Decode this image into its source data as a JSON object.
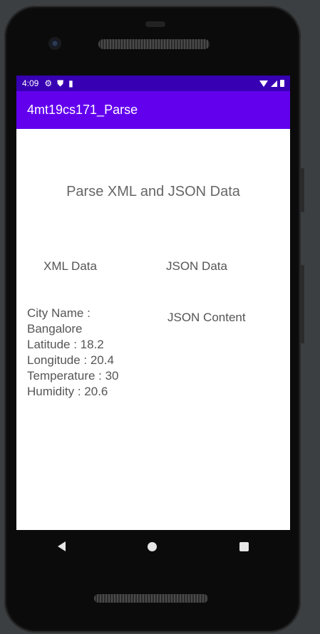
{
  "status_bar": {
    "time": "4:09",
    "icons_left": [
      "settings-icon",
      "shield-icon",
      "sd-card-icon"
    ],
    "icons_right": [
      "wifi-icon",
      "signal-icon",
      "battery-icon"
    ]
  },
  "app_bar": {
    "title": "4mt19cs171_Parse",
    "color": "#6200ee"
  },
  "status_bar_color": "#3700b3",
  "main": {
    "headline": "Parse XML and JSON Data",
    "xml_label": "XML Data",
    "json_label": "JSON Data",
    "xml_content": "City Name :\nBangalore\nLatitude : 18.2\nLongitude : 20.4\nTemperature : 30\nHumidity : 20.6",
    "json_content": "JSON Content"
  },
  "nav_bar": {
    "buttons": [
      "back-icon",
      "home-icon",
      "recents-icon"
    ]
  }
}
